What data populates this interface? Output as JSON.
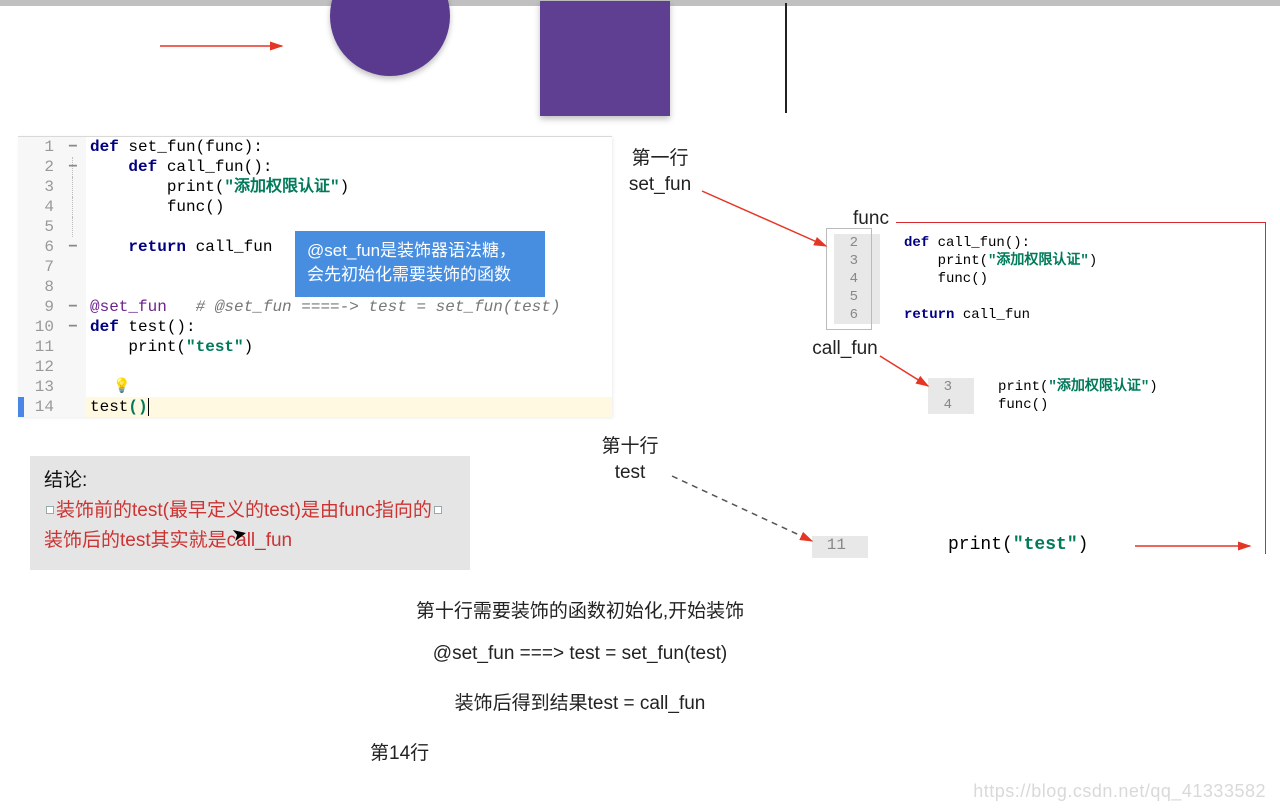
{
  "shapes": {
    "circle": "purple-circle",
    "square": "purple-square"
  },
  "editor": {
    "lines": [
      {
        "n": "1",
        "html": "<span class='kw'>def</span> <span class='fn'>set_fun</span>(func):"
      },
      {
        "n": "2",
        "html": "    <span class='kw'>def</span> <span class='fn'>call_fun</span>():"
      },
      {
        "n": "3",
        "html": "        print(<span class='str'>\"添加权限认证\"</span>)"
      },
      {
        "n": "4",
        "html": "        func()"
      },
      {
        "n": "5",
        "html": ""
      },
      {
        "n": "6",
        "html": "    <span class='kw'>return</span> call_fun"
      },
      {
        "n": "7",
        "html": ""
      },
      {
        "n": "8",
        "html": ""
      },
      {
        "n": "9",
        "html": "<span class='deco'>@set_fun</span>   <span class='cmt'># @set_fun ====-&gt; test = set_fun(test)</span>"
      },
      {
        "n": "10",
        "html": "<span class='kw'>def</span> <span class='fn'>test</span>():"
      },
      {
        "n": "11",
        "html": "    print(<span class='str'>\"test\"</span>)"
      },
      {
        "n": "12",
        "html": ""
      },
      {
        "n": "13",
        "html": ""
      },
      {
        "n": "14",
        "html": "test<span class='str'>()</span><span class='caret'></span>"
      }
    ],
    "current_line": 14,
    "bulb": "💡"
  },
  "tooltip": {
    "line1": "@set_fun是装饰器语法糖，",
    "line2": "会先初始化需要装饰的函数"
  },
  "conclusion": {
    "title": "结论:",
    "line1": "装饰前的test(最早定义的test)是由func指向的",
    "line2": "装饰后的test其实就是call_fun"
  },
  "explain": {
    "l1": "第十行需要装饰的函数初始化,开始装饰",
    "l2": "@set_fun ===> test = set_fun(test)",
    "l3": "装饰后得到结果test = call_fun",
    "l4": "第14行"
  },
  "right": {
    "label1a": "第一行",
    "label1b": "set_fun",
    "label_func": "func",
    "label_callfun": "call_fun",
    "label2a": "第十行",
    "label2b": "test",
    "snippet1": [
      {
        "n": "2",
        "html": "<span class='kw'>def</span> call_fun():"
      },
      {
        "n": "3",
        "html": "    print(<span class='str'>\"添加权限认证\"</span>)"
      },
      {
        "n": "4",
        "html": "    func()"
      },
      {
        "n": "5",
        "html": ""
      },
      {
        "n": "6",
        "html": "<span class='kw'>return</span> call_fun"
      }
    ],
    "snippet2": [
      {
        "n": "3",
        "html": "print(<span class='str'>\"添加权限认证\"</span>)"
      },
      {
        "n": "4",
        "html": "func()"
      }
    ],
    "snippet3": {
      "n": "11",
      "html": "print(<span class='str'>\"test\"</span>)"
    }
  },
  "watermark": "https://blog.csdn.net/qq_41333582"
}
